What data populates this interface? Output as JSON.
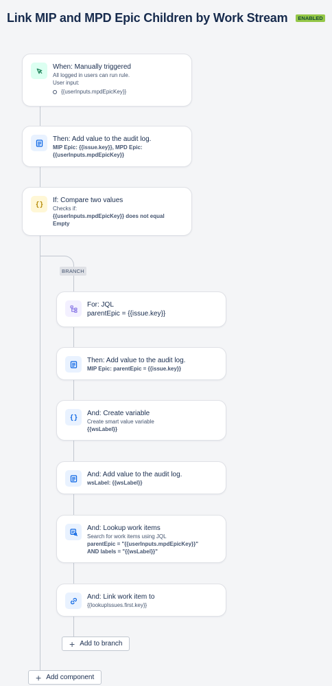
{
  "header": {
    "title": "Link MIP and MPD Epic Children by Work Stream",
    "status": "ENABLED"
  },
  "steps": {
    "trigger": {
      "title": "When: Manually triggered",
      "line1": "All logged in users can run rule.",
      "line2": "User input:",
      "bullet": "{{userInputs.mpdEpicKey}}"
    },
    "audit1": {
      "title": "Then: Add value to the audit log.",
      "bold1": "MIP Epic: {{issue.key}}, MPD Epic:",
      "bold2": "{{userInputs.mpdEpicKey}}"
    },
    "condition": {
      "title": "If: Compare two values",
      "line1": "Checks if:",
      "bold1": "{{userInputs.mpdEpicKey}} does not equal",
      "bold2": "Empty"
    },
    "branch_label": "BRANCH",
    "jql": {
      "title": "For: JQL",
      "line1": "parentEpic = {{issue.key}}"
    },
    "audit2": {
      "title": "Then: Add value to the audit log.",
      "bold1": "MIP Epic: parentEpic = {{issue.key}}"
    },
    "variable": {
      "title": "And: Create variable",
      "line1": "Create smart value variable",
      "bold1": "{{wsLabel}}"
    },
    "audit3": {
      "title": "And: Add value to the audit log.",
      "bold1": "wsLabel: {{wsLabel}}"
    },
    "lookup": {
      "title": "And: Lookup work items",
      "line1": "Search for work items using JQL",
      "bold1": "parentEpic = \"{{userInputs.mpdEpicKey}}\"",
      "bold2": "AND labels = \"{{wsLabel}}\""
    },
    "link": {
      "title": "And: Link work item to",
      "line1": "{{lookupIssues.first.key}}"
    }
  },
  "buttons": {
    "add_to_branch": "Add to branch",
    "add_component": "Add component"
  },
  "icons": {
    "trigger": "cursor-click-icon",
    "audit": "document-list-icon",
    "condition": "curly-braces-icon",
    "branch": "branch-icon",
    "link": "link-icon",
    "lookup": "search-list-icon"
  },
  "colors": {
    "enabled_badge": "#94c748",
    "trigger_icon_bg": "#dcfff1",
    "action_icon_bg": "#e9f2ff",
    "condition_icon_bg": "#fff7d6",
    "branch_icon_bg": "#f3f0ff"
  }
}
